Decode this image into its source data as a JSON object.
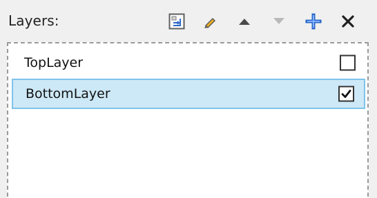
{
  "panel": {
    "title": "Layers:"
  },
  "toolbar": {
    "tools": [
      {
        "name": "layer-settings-icon"
      },
      {
        "name": "pencil-icon"
      },
      {
        "name": "move-up-icon"
      },
      {
        "name": "move-down-icon"
      },
      {
        "name": "add-icon"
      },
      {
        "name": "close-icon"
      }
    ],
    "colors": {
      "accent": "#2a67c8",
      "icon": "#444444",
      "icon_disabled": "#b9b9b9",
      "selection_fill": "#cde8f7",
      "selection_border": "#7ec3ea"
    }
  },
  "layers": [
    {
      "name": "TopLayer",
      "visible": false,
      "selected": false
    },
    {
      "name": "BottomLayer",
      "visible": true,
      "selected": true
    }
  ]
}
